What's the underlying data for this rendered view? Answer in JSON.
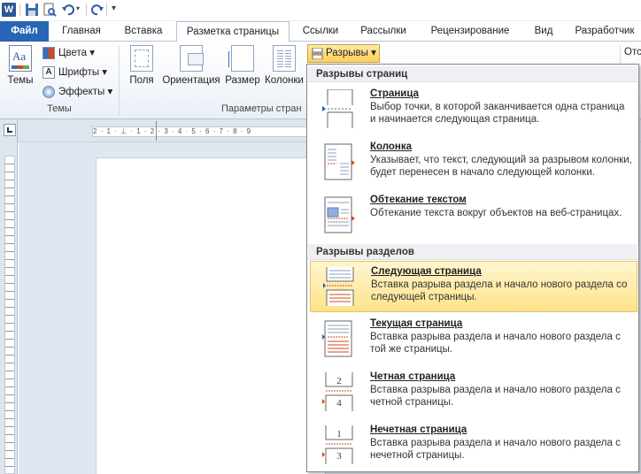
{
  "tabs": {
    "file": "Файл",
    "home": "Главная",
    "insert": "Вставка",
    "layout": "Разметка страницы",
    "references": "Ссылки",
    "mailings": "Рассылки",
    "review": "Рецензирование",
    "view": "Вид",
    "developer": "Разработчик"
  },
  "ribbon": {
    "themes": "Темы",
    "colors": "Цвета",
    "fonts": "Шрифты",
    "effects": "Эффекты",
    "themes_group": "Темы",
    "margins": "Поля",
    "orientation": "Ориентация",
    "size": "Размер",
    "columns": "Колонки",
    "page_setup_group": "Параметры стран",
    "breaks": "Разрывы",
    "partial_right": "Отс"
  },
  "ruler": {
    "text": "2 · 1 · ⊥ · 1 · 2 · 3 · 4 · 5 · 6 · 7 · 8 · 9"
  },
  "dropdown": {
    "page_breaks_header": "Разрывы страниц",
    "section_breaks_header": "Разрывы разделов",
    "items": [
      {
        "title": "Страница",
        "desc": "Выбор точки, в которой заканчивается одна страница и начинается следующая страница."
      },
      {
        "title": "Колонка",
        "desc": "Указывает, что текст, следующий за разрывом колонки, будет перенесен в начало следующей колонки."
      },
      {
        "title": "Обтекание текстом",
        "desc": "Обтекание текста вокруг объектов на веб-страницах."
      },
      {
        "title": "Следующая страница",
        "desc": "Вставка разрыва раздела и начало нового раздела со следующей страницы."
      },
      {
        "title": "Текущая страница",
        "desc": "Вставка разрыва раздела и начало нового раздела с той же страницы."
      },
      {
        "title": "Четная страница",
        "desc": "Вставка разрыва раздела и начало нового раздела с четной страницы."
      },
      {
        "title": "Нечетная страница",
        "desc": "Вставка разрыва раздела и начало нового раздела с нечетной страницы."
      }
    ],
    "icon_numbers": {
      "even_top": "2",
      "even_bottom": "4",
      "odd_top": "1",
      "odd_bottom": "3"
    }
  },
  "colors": {
    "file_tab": "#2a64b4",
    "highlight": "#ffe38a",
    "accent_red": "#d04a1c"
  }
}
